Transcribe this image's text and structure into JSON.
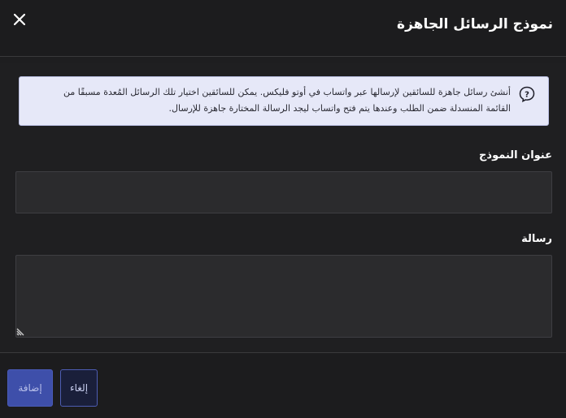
{
  "dialog": {
    "title": "نموذج الرسائل الجاهزة",
    "close_icon": "close-icon"
  },
  "info": {
    "icon": "question-icon",
    "text": "أنشئ رسائل جاهزة للسائقين لإرسالها عبر واتساب في أوتو فليكس. يمكن للسائقين اختيار تلك الرسائل المُعدة مسبقًا من القائمة المنسدلة ضمن الطلب وعندها يتم فتح واتساب ليجد الرسالة المختارة جاهزة للإرسال."
  },
  "form": {
    "template_name_label": "عنوان النموذج",
    "template_name_value": "",
    "message_label": "رسالة",
    "message_value": ""
  },
  "footer": {
    "add_label": "إضافة",
    "cancel_label": "إلغاء"
  },
  "colors": {
    "primary": "#3e4faa",
    "info_bg": "#e6e8f8",
    "background": "#1e1e20"
  }
}
